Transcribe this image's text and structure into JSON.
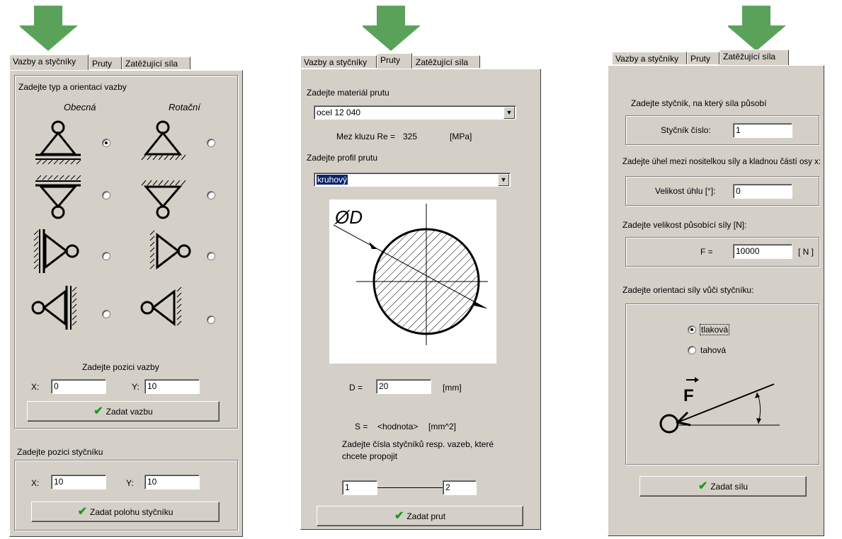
{
  "colors": {
    "arrow": "#5aa25a",
    "dialog": "#d4d0c8",
    "check": "#1a9a1a",
    "highlight": "#0a246a"
  },
  "panel1": {
    "tabs": [
      "Vazby a styčníky",
      "Pruty",
      "Zatěžující síla"
    ],
    "heading": "Zadejte typ a orientaci vazby",
    "col_general": "Obecná",
    "col_rotation": "Rotační",
    "support_icons": [
      "pinned-support-up-icon",
      "roller-support-up-icon",
      "pinned-support-down-icon",
      "roller-support-down-icon",
      "pinned-support-left-icon",
      "roller-support-left-icon",
      "pinned-support-right-icon",
      "roller-support-right-icon"
    ],
    "pos_label": "Zadejte pozici vazby",
    "x_label": "X:",
    "x_value": "0",
    "y_label": "Y:",
    "y_value": "10",
    "button": "Zadat vazbu",
    "node_heading": "Zadejte pozici styčníku",
    "node_x_label": "X:",
    "node_x_value": "10",
    "node_y_label": "Y:",
    "node_y_value": "10",
    "node_button": "Zadat polohu styčníku"
  },
  "panel2": {
    "tabs": [
      "Vazby a styčníky",
      "Pruty",
      "Zatěžující síla"
    ],
    "material_heading": "Zadejte materiál prutu",
    "material_value": "ocel 12 040",
    "yield_label": "Mez kluzu Re =",
    "yield_value": "325",
    "yield_unit": "[MPa]",
    "profile_heading": "Zadejte profil prutu",
    "profile_value": "kruhový",
    "diagram_label": "ØD",
    "d_label": "D =",
    "d_value": "20",
    "d_unit": "[mm]",
    "s_label": "S =",
    "s_value": "<hodnota>",
    "s_unit": "[mm^2]",
    "nodes_text": "Zadejte čísla styčníků resp. vazeb, které chcete propojit",
    "node_from": "1",
    "node_to": "2",
    "button": "Zadat prut"
  },
  "panel3": {
    "tabs": [
      "Vazby a styčníky",
      "Pruty",
      "Zatěžující síla"
    ],
    "node_heading": "Zadejte styčník, na který síla působí",
    "node_label": "Styčník číslo:",
    "node_value": "1",
    "angle_heading": "Zadejte úhel mezi nositelkou síly a kladnou částí  osy x:",
    "angle_label": "Velikost úhlu  [°]:",
    "angle_value": "0",
    "force_heading": "Zadejte velikost působící síly [N]:",
    "force_label": "F =",
    "force_value": "10000",
    "force_unit": "[ N ]",
    "orient_heading": "Zadejte orientaci síly vůči styčníku:",
    "radio_compression": "tlaková",
    "radio_tension": "tahová",
    "diagram_label": "F",
    "button": "Zadat sílu"
  }
}
